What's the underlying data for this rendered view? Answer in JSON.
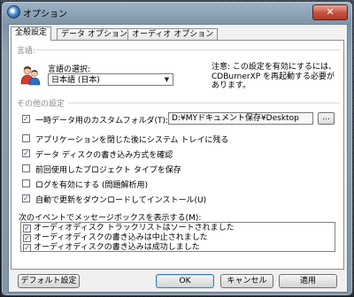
{
  "window": {
    "title": "オプション",
    "close_label": "✕"
  },
  "tabs": [
    {
      "label": "全般設定",
      "active": true
    },
    {
      "label": "データ オプション",
      "active": false
    },
    {
      "label": "オーディオ オプション",
      "active": false
    }
  ],
  "language": {
    "section_label": "言語:",
    "select_label": "言語の選択:",
    "selected_value": "日本語 (日本)",
    "note": "注意: この設定を有効にするには、CDBurnerXP を再起動する必要があります。"
  },
  "other": {
    "section_label": "その他の設定",
    "temp_folder": {
      "label": "一時データ用のカスタムフォルダ(T):",
      "checked": true,
      "value": "D:¥MYドキュメント保存¥Desktop",
      "browse_label": "..."
    },
    "options": [
      {
        "label": "アプリケーションを閉じた後にシステム トレイに残る",
        "checked": false
      },
      {
        "label": "データ ディスクの書き込み方式を確認",
        "checked": true
      },
      {
        "label": "前回使用したプロジェクト タイプを保存",
        "checked": false
      },
      {
        "label": "ログを有効にする (問題解析用)",
        "checked": false
      },
      {
        "label": "自動で更新をダウンロードしてインストール(U)",
        "checked": true
      }
    ]
  },
  "events": {
    "label": "次のイベントでメッセージボックスを表示する(M):",
    "items": [
      {
        "label": "オーディオディスク トラックリストはソートされました",
        "checked": true
      },
      {
        "label": "オーディオディスクの書き込みは中止されました",
        "checked": true
      },
      {
        "label": "オーディオディスクの書き込みは成功しました",
        "checked": true
      }
    ]
  },
  "buttons": {
    "default_settings": "デフォルト設定",
    "ok": "OK",
    "cancel": "キャンセル",
    "apply": "適用"
  },
  "icons": {
    "app": "cdburner-icon",
    "language": "users-language-icon"
  }
}
